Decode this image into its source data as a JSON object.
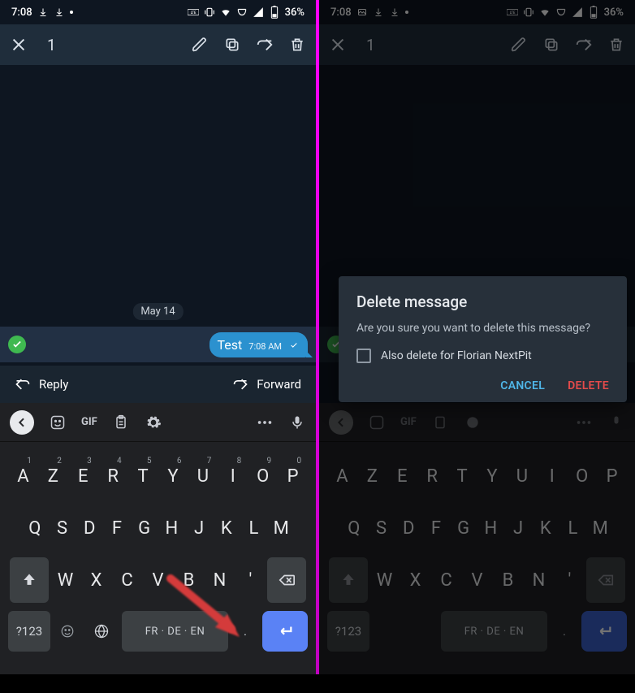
{
  "status": {
    "time": "7:08",
    "battery": "36%"
  },
  "toolbar": {
    "selected_count": "1"
  },
  "chat": {
    "date_chip": "May 14",
    "message_text": "Test",
    "message_time": "7:08 AM"
  },
  "actions": {
    "reply": "Reply",
    "forward": "Forward"
  },
  "keyboard": {
    "gif": "GIF",
    "row1": [
      "A",
      "Z",
      "E",
      "R",
      "T",
      "Y",
      "U",
      "I",
      "O",
      "P"
    ],
    "row1nums": [
      "1",
      "2",
      "3",
      "4",
      "5",
      "6",
      "7",
      "8",
      "9",
      "0"
    ],
    "row2": [
      "Q",
      "S",
      "D",
      "F",
      "G",
      "H",
      "J",
      "K",
      "L",
      "M"
    ],
    "row3": [
      "W",
      "X",
      "C",
      "V",
      "B",
      "N",
      "'"
    ],
    "sym": "?123",
    "space": "FR · DE · EN",
    "period": "."
  },
  "dialog": {
    "title": "Delete message",
    "body": "Are you sure you want to delete this message?",
    "checkbox_label": "Also delete for Florian NextPit",
    "cancel": "CANCEL",
    "delete": "DELETE"
  }
}
